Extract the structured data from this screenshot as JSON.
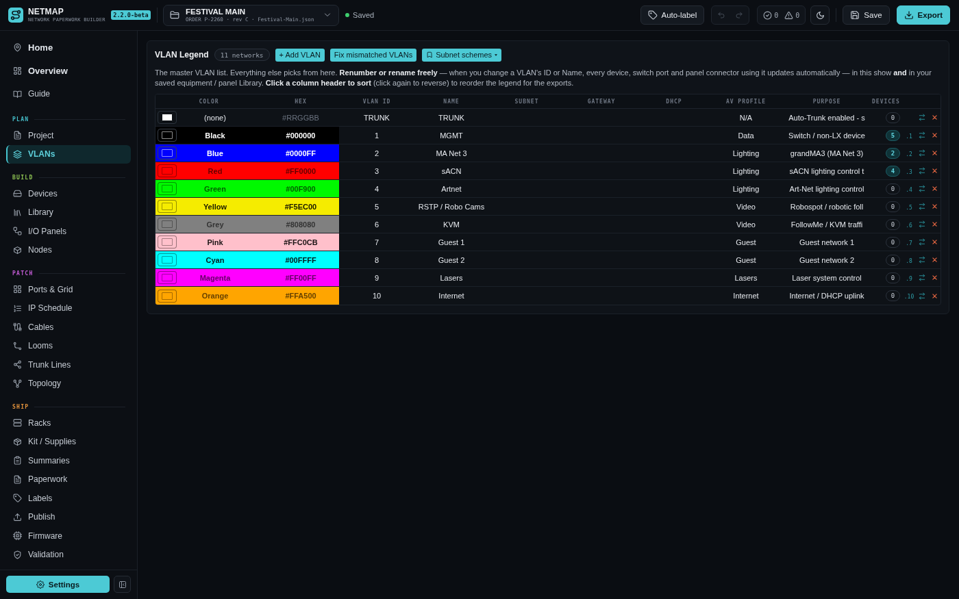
{
  "app": {
    "name": "NETMAP",
    "tagline": "NETWORK PAPERWORK BUILDER",
    "version": "2.2.0-beta"
  },
  "project": {
    "title": "FESTIVAL MAIN",
    "details": "ORDER P-2260 · rev C · Festival-Main.json"
  },
  "save_status": {
    "label": "Saved",
    "saved": true
  },
  "toolbar": {
    "auto_label": "Auto-label",
    "undo": {
      "disabled": true
    },
    "redo": {
      "disabled": true
    },
    "passed_count": "0",
    "warning_count": "0",
    "save": "Save",
    "export": "Export"
  },
  "sidebar": {
    "top_items": [
      {
        "label": "Home",
        "kind": "primary",
        "selected": false
      },
      {
        "label": "Overview",
        "kind": "primary",
        "selected": false
      },
      {
        "label": "Guide",
        "kind": "secondary",
        "selected": false
      }
    ],
    "sections": [
      {
        "title": "PLAN",
        "color": "#45bfca",
        "items": [
          {
            "label": "Project",
            "selected": false
          },
          {
            "label": "VLANs",
            "selected": true
          }
        ]
      },
      {
        "title": "BUILD",
        "color": "#8cc152",
        "items": [
          {
            "label": "Devices",
            "selected": false
          },
          {
            "label": "Library",
            "selected": false
          },
          {
            "label": "I/O Panels",
            "selected": false
          },
          {
            "label": "Nodes",
            "selected": false
          }
        ]
      },
      {
        "title": "PATCH",
        "color": "#c05ad2",
        "items": [
          {
            "label": "Ports & Grid",
            "selected": false
          },
          {
            "label": "IP Schedule",
            "selected": false
          },
          {
            "label": "Cables",
            "selected": false
          },
          {
            "label": "Looms",
            "selected": false
          },
          {
            "label": "Trunk Lines",
            "selected": false
          },
          {
            "label": "Topology",
            "selected": false
          }
        ]
      },
      {
        "title": "SHIP",
        "color": "#e0913c",
        "items": [
          {
            "label": "Racks",
            "selected": false
          },
          {
            "label": "Kit / Supplies",
            "selected": false
          },
          {
            "label": "Summaries",
            "selected": false
          },
          {
            "label": "Paperwork",
            "selected": false
          },
          {
            "label": "Labels",
            "selected": false
          },
          {
            "label": "Publish",
            "selected": false
          },
          {
            "label": "Firmware",
            "selected": false
          },
          {
            "label": "Validation",
            "selected": false
          }
        ]
      }
    ],
    "settings": "Settings"
  },
  "vlan_legend": {
    "title": "VLAN Legend",
    "count": "11 networks",
    "buttons": [
      {
        "label": "+ Add VLAN",
        "kind": "action"
      },
      {
        "label": "Fix mismatched VLANs",
        "kind": "action"
      },
      {
        "label": "Subnet schemes",
        "kind": "menu"
      }
    ],
    "description": "The master VLAN list. Everything else picks from here. **Renumber or rename freely** — when you change a VLAN's ID or Name, every device, switch port and panel connector using it updates automatically — in this show **and** in your saved equipment / panel Library. **Click a column header to sort** (click again to reverse) to reorder the legend for the exports.",
    "table": {
      "columns": [
        "COLOR",
        "HEX",
        "VLAN ID",
        "NAME",
        "SUBNET",
        "GATEWAY",
        "DHCP",
        "AV PROFILE",
        "PURPOSE",
        "DEVICES"
      ],
      "rows": [
        {
          "color_name": "(none)",
          "placeholder": "#RRGGBB",
          "vlan_id": "TRUNK",
          "name": "TRUNK",
          "av_profile": "N/A",
          "purpose": "Auto-Trunk enabled - s",
          "devices": "0",
          "in_use": false
        },
        {
          "color_name": "Black",
          "hex": "#000000",
          "color": "#000000",
          "vlan_id": "1",
          "name": "MGMT",
          "av_profile": "Data",
          "purpose": "Switch / non-LX device",
          "devices": "5",
          "in_use": true,
          "host_suffix": ".1"
        },
        {
          "color_name": "Blue",
          "hex": "#0000FF",
          "color": "#0000ff",
          "vlan_id": "2",
          "name": "MA Net 3",
          "av_profile": "Lighting",
          "purpose": "grandMA3 (MA Net 3)",
          "devices": "2",
          "in_use": true,
          "host_suffix": ".2"
        },
        {
          "color_name": "Red",
          "hex": "#FF0000",
          "color": "#ff0000",
          "vlan_id": "3",
          "name": "sACN",
          "av_profile": "Lighting",
          "purpose": "sACN lighting control t",
          "devices": "4",
          "in_use": true,
          "host_suffix": ".3"
        },
        {
          "color_name": "Green",
          "hex": "#00F900",
          "color": "#00f900",
          "vlan_id": "4",
          "name": "Artnet",
          "av_profile": "Lighting",
          "purpose": "Art-Net lighting control",
          "devices": "0",
          "in_use": false,
          "host_suffix": ".4"
        },
        {
          "color_name": "Yellow",
          "hex": "#F5EC00",
          "color": "#f5ec00",
          "vlan_id": "5",
          "name": "RSTP / Robo Cams",
          "av_profile": "Video",
          "purpose": "Robospot / robotic foll",
          "devices": "0",
          "in_use": false,
          "host_suffix": ".5"
        },
        {
          "color_name": "Grey",
          "hex": "#808080",
          "color": "#808080",
          "vlan_id": "6",
          "name": "KVM",
          "av_profile": "Video",
          "purpose": "FollowMe / KVM traffi",
          "devices": "0",
          "in_use": false,
          "host_suffix": ".6"
        },
        {
          "color_name": "Pink",
          "hex": "#FFC0CB",
          "color": "#ffc0cb",
          "vlan_id": "7",
          "name": "Guest 1",
          "av_profile": "Guest",
          "purpose": "Guest network 1",
          "devices": "0",
          "in_use": false,
          "host_suffix": ".7"
        },
        {
          "color_name": "Cyan",
          "hex": "#00FFFF",
          "color": "#00ffff",
          "vlan_id": "8",
          "name": "Guest 2",
          "av_profile": "Guest",
          "purpose": "Guest network 2",
          "devices": "0",
          "in_use": false,
          "host_suffix": ".8"
        },
        {
          "color_name": "Magenta",
          "hex": "#FF00FF",
          "color": "#ff00ff",
          "vlan_id": "9",
          "name": "Lasers",
          "av_profile": "Lasers",
          "purpose": "Laser system control",
          "devices": "0",
          "in_use": false,
          "host_suffix": ".9"
        },
        {
          "color_name": "Orange",
          "hex": "#FFA500",
          "color": "#ffa500",
          "vlan_id": "10",
          "name": "Internet",
          "av_profile": "Internet",
          "purpose": "Internet / DHCP uplink",
          "devices": "0",
          "in_use": false,
          "host_suffix": ".10"
        }
      ]
    }
  }
}
